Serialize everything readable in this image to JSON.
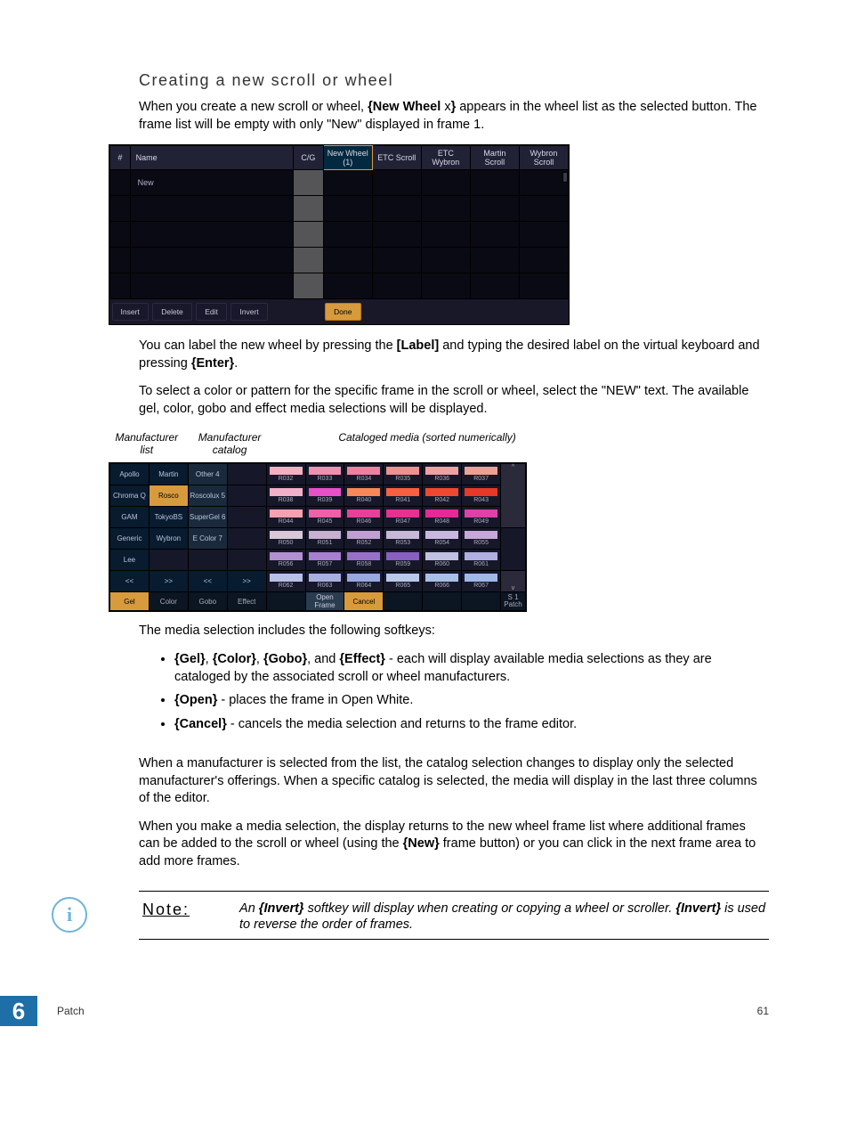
{
  "heading": "Creating a new scroll or wheel",
  "p1a": "When you create a new scroll or wheel, ",
  "p1b": "{New Wheel ",
  "p1c": "x",
  "p1d": "}",
  "p1e": " appears in the wheel list as the selected button. The frame list will be empty with only \"New\" displayed in frame 1.",
  "ss1": {
    "cols": {
      "num": "#",
      "name": "Name",
      "cg": "C/G"
    },
    "wheels": [
      "New Wheel (1)",
      "ETC Scroll",
      "ETC Wybron",
      "Martin Scroll",
      "Wybron Scroll"
    ],
    "row1": "New",
    "btns": {
      "insert": "Insert",
      "delete": "Delete",
      "edit": "Edit",
      "invert": "Invert",
      "done": "Done"
    }
  },
  "p2a": "You can label the new wheel by pressing the ",
  "p2b": "[Label]",
  "p2c": " and typing the desired label on the virtual keyboard and pressing ",
  "p2d": "{Enter}",
  "p2e": ".",
  "p3": "To select a color or pattern for the specific frame in the scroll or wheel, select the \"NEW\" text. The available gel, color, gobo and effect media selections will be displayed.",
  "labels": {
    "mlist": "Manufacturer list",
    "mcat": "Manufacturer catalog",
    "media": "Cataloged media (sorted numerically)"
  },
  "ss2": {
    "mfr": [
      "Apollo",
      "Martin",
      "Other 4",
      "Chroma Q",
      "Rosco",
      "Roscolux 5",
      "GAM",
      "TokyoBS",
      "SuperGel 6",
      "Generic",
      "Wybron",
      "E Color 7",
      "Lee"
    ],
    "nav": {
      "pl": "<<",
      "pr": ">>",
      "cl": "<<",
      "cr": ">>"
    },
    "chips": [
      [
        "R032",
        "R033",
        "R034",
        "R035",
        "R036",
        "R037"
      ],
      [
        "R038",
        "R039",
        "R040",
        "R041",
        "R042",
        "R043"
      ],
      [
        "R044",
        "R045",
        "R046",
        "R047",
        "R048",
        "R049"
      ],
      [
        "R050",
        "R051",
        "R052",
        "R053",
        "R054",
        "R055"
      ],
      [
        "R056",
        "R057",
        "R058",
        "R059",
        "R060",
        "R061"
      ],
      [
        "R062",
        "R063",
        "R064",
        "R065",
        "R066",
        "R067"
      ]
    ],
    "scroll": {
      "up": "^",
      "dn": "v"
    },
    "bottom": {
      "gel": "Gel",
      "color": "Color",
      "gobo": "Gobo",
      "effect": "Effect",
      "open": "Open Frame",
      "cancel": "Cancel",
      "patch": "S 1 Patch"
    }
  },
  "p4": "The media selection includes the following softkeys:",
  "li1a": "{Gel}",
  "li1b": "{Color}",
  "li1c": "{Gobo}",
  "li1d": "{Effect}",
  "li1e": " - each will display available media selections as they are cataloged by the associated scroll or wheel manufacturers.",
  "li2a": "{Open}",
  "li2b": " - places the frame in Open White.",
  "li3a": "{Cancel}",
  "li3b": " - cancels the media selection and returns to the frame editor.",
  "p5": "When a manufacturer is selected from the list, the catalog selection changes to display only the selected manufacturer's offerings. When a specific catalog is selected, the media will display in the last three columns of the editor.",
  "p6a": "When you make a media selection, the display returns to the new wheel frame list where additional frames can be added to the scroll or wheel (using the ",
  "p6b": "{New}",
  "p6c": " frame button) or you can click in the next frame area to add more frames.",
  "note": {
    "label": "Note:",
    "t1": "An ",
    "t2": "{Invert}",
    "t3": " softkey will display when creating or copying a wheel or scroller. ",
    "t4": "{Invert}",
    "t5": " is used to reverse the order of frames."
  },
  "footer": {
    "chap": "6",
    "sec": "Patch",
    "page": "61"
  }
}
